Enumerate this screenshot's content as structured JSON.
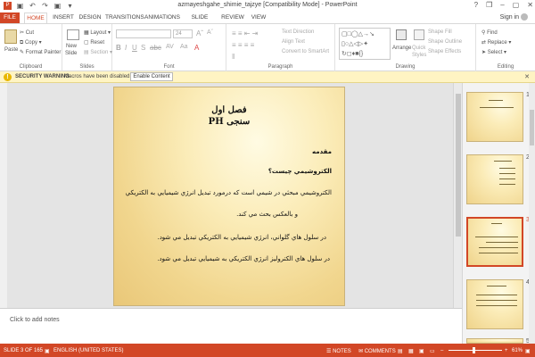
{
  "window": {
    "title": "azmayeshgahe_shimie_tajzye [Compatibility Mode] - PowerPoint",
    "controls": [
      "?",
      "❒",
      "–",
      "▢",
      "✕"
    ]
  },
  "tabs": [
    {
      "label": "FILE"
    },
    {
      "label": "HOME"
    },
    {
      "label": "INSERT"
    },
    {
      "label": "DESIGN"
    },
    {
      "label": "TRANSITIONS"
    },
    {
      "label": "ANIMATIONS"
    },
    {
      "label": "SLIDE SHOW"
    },
    {
      "label": "REVIEW"
    },
    {
      "label": "VIEW"
    }
  ],
  "signin": "Sign in",
  "ribbon": {
    "clipboard": {
      "label": "Clipboard",
      "paste": "Paste",
      "cut": "Cut",
      "copy": "Copy",
      "format_painter": "Format Painter"
    },
    "slides": {
      "label": "Slides",
      "new_slide": "New",
      "new_slide2": "Slide",
      "layout": "Layout",
      "reset": "Reset",
      "section": "Section"
    },
    "font": {
      "label": "Font",
      "size": "24"
    },
    "paragraph": {
      "label": "Paragraph",
      "text_direction": "Text Direction",
      "align_text": "Align Text",
      "convert": "Convert to SmartArt"
    },
    "drawing": {
      "label": "Drawing",
      "arrange": "Arrange",
      "quick_styles": "Quick",
      "quick_styles2": "Styles",
      "shape_fill": "Shape Fill",
      "shape_outline": "Shape Outline",
      "shape_effects": "Shape Effects"
    },
    "editing": {
      "label": "Editing",
      "find": "Find",
      "replace": "Replace",
      "select": "Select"
    }
  },
  "security": {
    "title": "SECURITY WARNING",
    "message": "Macros have been disabled.",
    "button": "Enable Content"
  },
  "slide": {
    "title1": "فصل اول",
    "title2": "PH سنجی",
    "lines": [
      "مقدمه",
      "الكتروشيمي چيست؟",
      "الكتروشيمي مبحثي در شيمي است كه درمورد تبديل انرژي شيميايي به الكتريكي",
      "و بالعكس بحث مي كند.",
      "در سلول هاي گلواني، انرژي شيميايي به الكتريكي تبديل مي شود.",
      "در سلول هاي الكتروليز انرژي الكتريكي به شيميايي تبديل مي شود."
    ]
  },
  "thumbnails": [
    "1",
    "2",
    "3",
    "4",
    "5"
  ],
  "notes_placeholder": "Click to add notes",
  "status": {
    "slide": "SLIDE 3 OF 165",
    "language": "ENGLISH (UNITED STATES)",
    "notes": "NOTES",
    "comments": "COMMENTS",
    "zoom": "61%"
  },
  "colors": {
    "accent": "#d24726",
    "warning_bg": "#fff4c3"
  }
}
